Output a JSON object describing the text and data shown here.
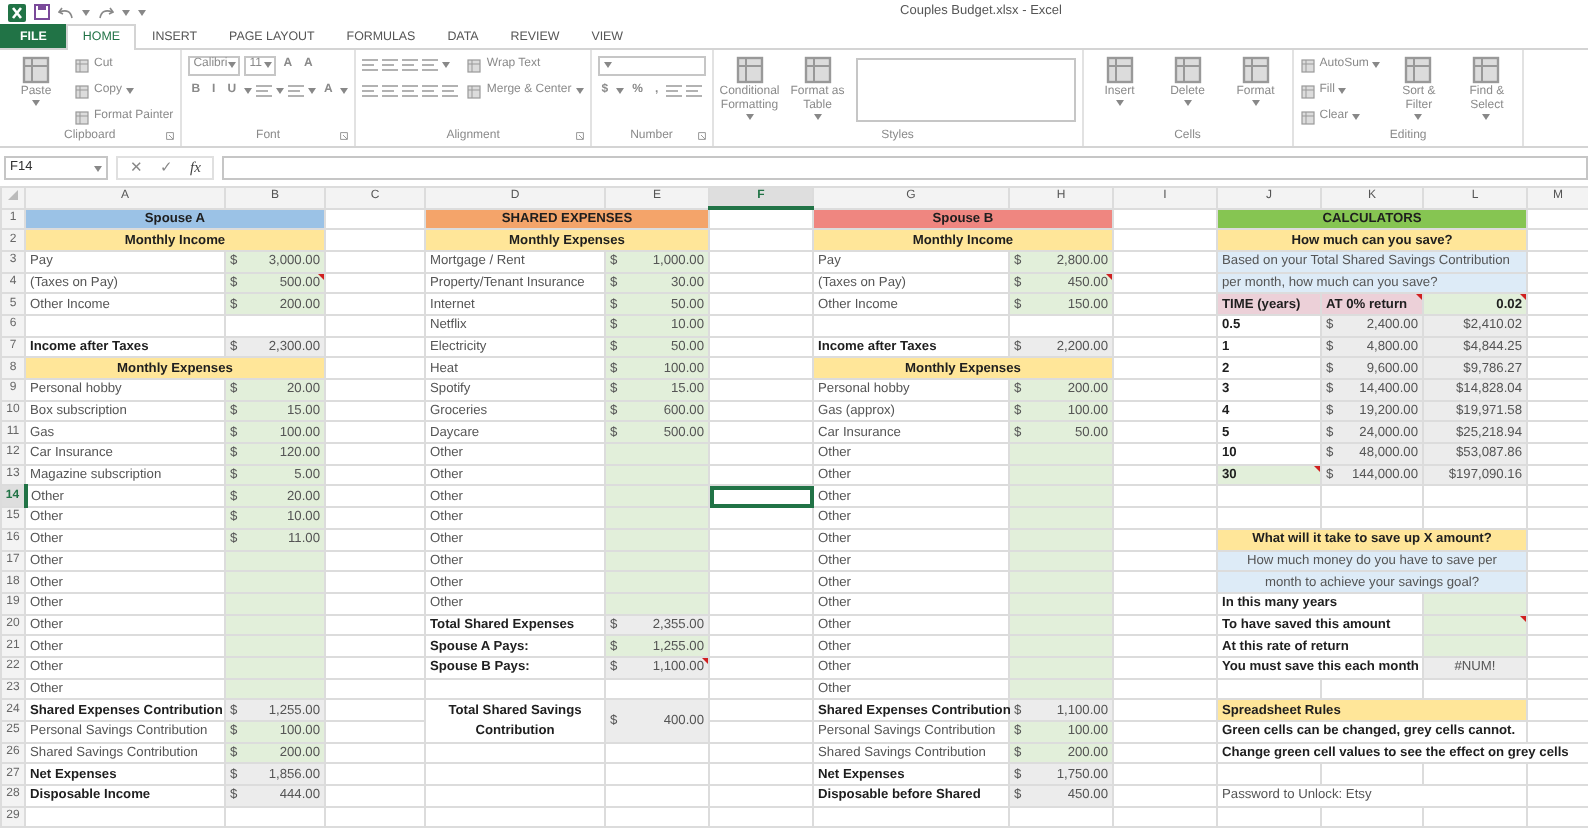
{
  "window": {
    "title": "Couples Budget.xlsx - Excel"
  },
  "tabs": [
    {
      "label": "FILE",
      "kind": "file",
      "selected": false
    },
    {
      "label": "HOME",
      "kind": "tab",
      "selected": true
    },
    {
      "label": "INSERT",
      "kind": "tab",
      "selected": false
    },
    {
      "label": "PAGE LAYOUT",
      "kind": "tab",
      "selected": false
    },
    {
      "label": "FORMULAS",
      "kind": "tab",
      "selected": false
    },
    {
      "label": "DATA",
      "kind": "tab",
      "selected": false
    },
    {
      "label": "REVIEW",
      "kind": "tab",
      "selected": false
    },
    {
      "label": "VIEW",
      "kind": "tab",
      "selected": false
    }
  ],
  "ribbon": {
    "disabled": true,
    "groups": [
      {
        "label": "Clipboard",
        "launcher": true,
        "columns": [
          [
            [
              {
                "kind": "large",
                "text": "Paste",
                "menu": true
              }
            ]
          ],
          [
            [
              {
                "kind": "small",
                "text": "Cut"
              }
            ],
            [
              {
                "kind": "small",
                "text": "Copy",
                "menu": true
              }
            ],
            [
              {
                "kind": "small",
                "text": "Format Painter"
              }
            ]
          ]
        ]
      },
      {
        "label": "Font",
        "launcher": true,
        "columns": [
          [
            [
              {
                "kind": "combo",
                "text": "Calibri"
              },
              {
                "kind": "combo",
                "text": "11"
              },
              {
                "kind": "glyph",
                "text": "A"
              },
              {
                "kind": "glyph",
                "text": "A"
              }
            ],
            [
              {
                "kind": "glyph",
                "text": "B"
              },
              {
                "kind": "glyph",
                "text": "I"
              },
              {
                "kind": "glyph",
                "text": "U",
                "menu": true
              },
              {
                "kind": "icon",
                "menu": true
              },
              {
                "kind": "icon",
                "menu": true
              },
              {
                "kind": "glyph",
                "text": "A",
                "menu": true
              }
            ]
          ]
        ]
      },
      {
        "label": "Alignment",
        "launcher": true,
        "columns": [
          [
            [
              {
                "kind": "icon"
              },
              {
                "kind": "icon"
              },
              {
                "kind": "icon"
              },
              {
                "kind": "icon",
                "menu": true
              }
            ],
            [
              {
                "kind": "icon"
              },
              {
                "kind": "icon"
              },
              {
                "kind": "icon"
              },
              {
                "kind": "icon"
              },
              {
                "kind": "icon"
              }
            ]
          ],
          [
            [
              {
                "kind": "small",
                "text": "Wrap Text"
              }
            ],
            [
              {
                "kind": "small",
                "text": "Merge & Center",
                "menu": true
              }
            ]
          ]
        ]
      },
      {
        "label": "Number",
        "launcher": true,
        "columns": [
          [
            [
              {
                "kind": "select"
              }
            ],
            [
              {
                "kind": "glyph",
                "text": "$",
                "menu": true
              },
              {
                "kind": "glyph",
                "text": "%"
              },
              {
                "kind": "glyph",
                "text": ","
              },
              {
                "kind": "icon"
              },
              {
                "kind": "icon"
              }
            ]
          ]
        ]
      },
      {
        "label": "Styles",
        "columns": [
          [
            [
              {
                "kind": "large",
                "text": "Conditional Formatting",
                "menu": true
              }
            ]
          ],
          [
            [
              {
                "kind": "large",
                "text": "Format as Table",
                "menu": true
              }
            ]
          ],
          [
            [
              {
                "kind": "gallery"
              }
            ]
          ]
        ]
      },
      {
        "label": "Cells",
        "columns": [
          [
            [
              {
                "kind": "large",
                "text": "Insert",
                "menu": true
              }
            ]
          ],
          [
            [
              {
                "kind": "large",
                "text": "Delete",
                "menu": true
              }
            ]
          ],
          [
            [
              {
                "kind": "large",
                "text": "Format",
                "menu": true
              }
            ]
          ]
        ]
      },
      {
        "label": "Editing",
        "columns": [
          [
            [
              {
                "kind": "small",
                "text": "AutoSum",
                "menu": true
              }
            ],
            [
              {
                "kind": "small",
                "text": "Fill",
                "menu": true
              }
            ],
            [
              {
                "kind": "small",
                "text": "Clear",
                "menu": true
              }
            ]
          ],
          [
            [
              {
                "kind": "large",
                "text": "Sort & Filter",
                "menu": true
              }
            ]
          ],
          [
            [
              {
                "kind": "large",
                "text": "Find & Select",
                "menu": true
              }
            ]
          ]
        ]
      }
    ]
  },
  "formula_bar": {
    "name_box": "F14",
    "cancel": "✕",
    "enter": "✓",
    "function": "fx"
  },
  "sheet": {
    "columns": [
      {
        "label": "A",
        "selected": false
      },
      {
        "label": "B",
        "selected": false
      },
      {
        "label": "C",
        "selected": false
      },
      {
        "label": "D",
        "selected": false
      },
      {
        "label": "E",
        "selected": false
      },
      {
        "label": "F",
        "selected": true
      },
      {
        "label": "G",
        "selected": false
      },
      {
        "label": "H",
        "selected": false
      },
      {
        "label": "I",
        "selected": false
      },
      {
        "label": "J",
        "selected": false
      },
      {
        "label": "K",
        "selected": false
      },
      {
        "label": "L",
        "selected": false
      },
      {
        "label": "M",
        "selected": false
      }
    ],
    "rows": [
      {
        "number": "1",
        "selected": false,
        "cells": [
          {
            "text": "Spouse A",
            "kind": "title",
            "color": "#9bc2e6",
            "bold": true,
            "colspan": 2
          },
          "",
          {
            "text": "SHARED EXPENSES",
            "kind": "title",
            "color": "#f4a46a",
            "bold": true,
            "colspan": 2
          },
          "",
          {
            "text": "Spouse B",
            "kind": "title",
            "color": "#ef8680",
            "bold": true,
            "colspan": 2
          },
          "",
          {
            "text": "CALCULATORS",
            "kind": "title",
            "color": "#86c552",
            "bold": true,
            "colspan": 3
          }
        ]
      },
      {
        "number": "2",
        "selected": false,
        "cells": [
          {
            "text": "Monthly Income",
            "kind": "section",
            "bold": true,
            "colspan": 2
          },
          "",
          {
            "text": "Monthly Expenses",
            "kind": "section",
            "bold": true,
            "colspan": 2
          },
          "",
          {
            "text": "Monthly Income",
            "kind": "section",
            "bold": true,
            "colspan": 2
          },
          "",
          {
            "text": "How much can you save?",
            "kind": "section",
            "bold": true,
            "colspan": 3
          }
        ]
      },
      {
        "number": "3",
        "selected": false,
        "cells": [
          "Pay",
          {
            "currency": "$",
            "text": "3,000.00",
            "kind": "input"
          },
          "",
          "Mortgage / Rent",
          {
            "currency": "$",
            "text": "1,000.00",
            "kind": "input"
          },
          "",
          "Pay",
          {
            "currency": "$",
            "text": "2,800.00",
            "kind": "input"
          },
          "",
          {
            "text": "Based on your Total Shared Savings Contribution",
            "kind": "note",
            "colspan": 3
          }
        ]
      },
      {
        "number": "4",
        "selected": false,
        "cells": [
          "(Taxes on Pay)",
          {
            "currency": "$",
            "text": "500.00",
            "kind": "input",
            "comment": true
          },
          "",
          "Property/Tenant Insurance",
          {
            "currency": "$",
            "text": "30.00",
            "kind": "input"
          },
          "",
          "(Taxes on Pay)",
          {
            "currency": "$",
            "text": "450.00",
            "kind": "input",
            "comment": true
          },
          "",
          {
            "text": "per month, how much can you save?",
            "kind": "note",
            "colspan": 3
          }
        ]
      },
      {
        "number": "5",
        "selected": false,
        "cells": [
          "Other Income",
          {
            "currency": "$",
            "text": "200.00",
            "kind": "input"
          },
          "",
          "Internet",
          {
            "currency": "$",
            "text": "50.00",
            "kind": "input"
          },
          "",
          "Other Income",
          {
            "currency": "$",
            "text": "150.00",
            "kind": "input"
          },
          "",
          {
            "text": "TIME (years)",
            "kind": "label",
            "bold": true
          },
          {
            "text": "AT 0% return",
            "kind": "label",
            "bold": true,
            "comment": true
          },
          {
            "text": "0.02",
            "kind": "rate",
            "bold": true,
            "comment": true
          }
        ]
      },
      {
        "number": "6",
        "selected": false,
        "cells": [
          "",
          "",
          "",
          "Netflix",
          {
            "currency": "$",
            "text": "10.00",
            "kind": "input"
          },
          "",
          "",
          "",
          "",
          {
            "text": "0.5",
            "bold": true
          },
          {
            "currency": "$",
            "text": "2,400.00",
            "kind": "formula"
          },
          {
            "text": "$2,410.02",
            "kind": "formula"
          }
        ]
      },
      {
        "number": "7",
        "selected": false,
        "cells": [
          {
            "text": "Income after Taxes",
            "bold": true
          },
          {
            "currency": "$",
            "text": "2,300.00",
            "kind": "formula"
          },
          "",
          "Electricity",
          {
            "currency": "$",
            "text": "50.00",
            "kind": "input"
          },
          "",
          {
            "text": "Income after Taxes",
            "bold": true
          },
          {
            "currency": "$",
            "text": "2,200.00",
            "kind": "formula"
          },
          "",
          {
            "text": "1",
            "bold": true
          },
          {
            "currency": "$",
            "text": "4,800.00",
            "kind": "formula"
          },
          {
            "text": "$4,844.25",
            "kind": "formula"
          }
        ]
      },
      {
        "number": "8",
        "selected": false,
        "cells": [
          {
            "text": "Monthly Expenses",
            "kind": "section",
            "bold": true,
            "colspan": 2
          },
          "",
          "Heat",
          {
            "currency": "$",
            "text": "100.00",
            "kind": "input"
          },
          "",
          {
            "text": "Monthly Expenses",
            "kind": "section",
            "bold": true,
            "colspan": 2
          },
          "",
          {
            "text": "2",
            "bold": true
          },
          {
            "currency": "$",
            "text": "9,600.00",
            "kind": "formula"
          },
          {
            "text": "$9,786.27",
            "kind": "formula"
          }
        ]
      },
      {
        "number": "9",
        "selected": false,
        "cells": [
          "Personal hobby",
          {
            "currency": "$",
            "text": "20.00",
            "kind": "input"
          },
          "",
          "Spotify",
          {
            "currency": "$",
            "text": "15.00",
            "kind": "input"
          },
          "",
          "Personal hobby",
          {
            "currency": "$",
            "text": "200.00",
            "kind": "input"
          },
          "",
          {
            "text": "3",
            "bold": true
          },
          {
            "currency": "$",
            "text": "14,400.00",
            "kind": "formula"
          },
          {
            "text": "$14,828.04",
            "kind": "formula"
          }
        ]
      },
      {
        "number": "10",
        "selected": false,
        "cells": [
          "Box subscription",
          {
            "currency": "$",
            "text": "15.00",
            "kind": "input"
          },
          "",
          "Groceries",
          {
            "currency": "$",
            "text": "600.00",
            "kind": "input"
          },
          "",
          "Gas (approx)",
          {
            "currency": "$",
            "text": "100.00",
            "kind": "input"
          },
          "",
          {
            "text": "4",
            "bold": true
          },
          {
            "currency": "$",
            "text": "19,200.00",
            "kind": "formula"
          },
          {
            "text": "$19,971.58",
            "kind": "formula"
          }
        ]
      },
      {
        "number": "11",
        "selected": false,
        "cells": [
          "Gas",
          {
            "currency": "$",
            "text": "100.00",
            "kind": "input"
          },
          "",
          "Daycare",
          {
            "currency": "$",
            "text": "500.00",
            "kind": "input"
          },
          "",
          "Car Insurance",
          {
            "currency": "$",
            "text": "50.00",
            "kind": "input"
          },
          "",
          {
            "text": "5",
            "bold": true
          },
          {
            "currency": "$",
            "text": "24,000.00",
            "kind": "formula"
          },
          {
            "text": "$25,218.94",
            "kind": "formula"
          }
        ]
      },
      {
        "number": "12",
        "selected": false,
        "cells": [
          "Car Insurance",
          {
            "currency": "$",
            "text": "120.00",
            "kind": "input"
          },
          "",
          "Other",
          {
            "kind": "input"
          },
          "",
          "Other",
          {
            "kind": "input"
          },
          "",
          {
            "text": "10",
            "bold": true
          },
          {
            "currency": "$",
            "text": "48,000.00",
            "kind": "formula"
          },
          {
            "text": "$53,087.86",
            "kind": "formula"
          }
        ]
      },
      {
        "number": "13",
        "selected": false,
        "cells": [
          "Magazine subscription",
          {
            "currency": "$",
            "text": "5.00",
            "kind": "input"
          },
          "",
          "Other",
          {
            "kind": "input"
          },
          "",
          "Other",
          {
            "kind": "input"
          },
          "",
          {
            "text": "30",
            "kind": "input",
            "bold": true,
            "comment": true
          },
          {
            "currency": "$",
            "text": "144,000.00",
            "kind": "formula"
          },
          {
            "text": "$197,090.16",
            "kind": "formula"
          }
        ]
      },
      {
        "number": "14",
        "selected": true,
        "cells": [
          "Other",
          {
            "currency": "$",
            "text": "20.00",
            "kind": "input"
          },
          "",
          "Other",
          {
            "kind": "input"
          },
          "",
          "Other",
          {
            "kind": "input"
          }
        ]
      },
      {
        "number": "15",
        "selected": false,
        "cells": [
          "Other",
          {
            "currency": "$",
            "text": "10.00",
            "kind": "input"
          },
          "",
          "Other",
          {
            "kind": "input"
          },
          "",
          "Other",
          {
            "kind": "input"
          }
        ]
      },
      {
        "number": "16",
        "selected": false,
        "cells": [
          "Other",
          {
            "currency": "$",
            "text": "11.00",
            "kind": "input"
          },
          "",
          "Other",
          {
            "kind": "input"
          },
          "",
          "Other",
          {
            "kind": "input"
          },
          "",
          {
            "text": "What will it take to save up X amount?",
            "kind": "section",
            "bold": true,
            "colspan": 3
          }
        ]
      },
      {
        "number": "17",
        "selected": false,
        "cells": [
          "Other",
          {
            "kind": "input"
          },
          "",
          "Other",
          {
            "kind": "input"
          },
          "",
          "Other",
          {
            "kind": "input"
          },
          "",
          {
            "text": "How much money do you have to save per",
            "kind": "prompt",
            "colspan": 3
          }
        ]
      },
      {
        "number": "18",
        "selected": false,
        "cells": [
          "Other",
          {
            "kind": "input"
          },
          "",
          "Other",
          {
            "kind": "input"
          },
          "",
          "Other",
          {
            "kind": "input"
          },
          "",
          {
            "text": "month to achieve your savings goal?",
            "kind": "prompt",
            "colspan": 3
          }
        ]
      },
      {
        "number": "19",
        "selected": false,
        "cells": [
          "Other",
          {
            "kind": "input"
          },
          "",
          "Other",
          {
            "kind": "input"
          },
          "",
          "Other",
          {
            "kind": "input"
          },
          "",
          {
            "text": "In this many years",
            "bold": true,
            "colspan": 2
          },
          {
            "kind": "input"
          }
        ]
      },
      {
        "number": "20",
        "selected": false,
        "cells": [
          "Other",
          {
            "kind": "input"
          },
          "",
          {
            "text": "Total Shared Expenses",
            "bold": true
          },
          {
            "currency": "$",
            "text": "2,355.00",
            "kind": "formula"
          },
          "",
          "Other",
          {
            "kind": "input"
          },
          "",
          {
            "text": "To have saved this amount",
            "bold": true,
            "colspan": 2
          },
          {
            "kind": "input",
            "comment": true
          }
        ]
      },
      {
        "number": "21",
        "selected": false,
        "cells": [
          "Other",
          {
            "kind": "input"
          },
          "",
          {
            "text": "Spouse A Pays:",
            "bold": true
          },
          {
            "currency": "$",
            "text": "1,255.00",
            "kind": "input"
          },
          "",
          "Other",
          {
            "kind": "input"
          },
          "",
          {
            "text": "At this rate of return",
            "bold": true,
            "colspan": 2
          },
          {
            "kind": "input"
          }
        ]
      },
      {
        "number": "22",
        "selected": false,
        "cells": [
          "Other",
          {
            "kind": "input"
          },
          "",
          {
            "text": "Spouse B Pays:",
            "bold": true
          },
          {
            "currency": "$",
            "text": "1,100.00",
            "kind": "formula",
            "comment": true
          },
          "",
          "Other",
          {
            "kind": "input"
          },
          "",
          {
            "text": "You must save this each month",
            "bold": true,
            "colspan": 2
          },
          {
            "text": "#NUM!",
            "kind": "error"
          }
        ]
      },
      {
        "number": "23",
        "selected": false,
        "cells": [
          "Other",
          {
            "kind": "input"
          },
          "",
          "",
          "",
          "",
          "Other",
          {
            "kind": "input"
          }
        ]
      },
      {
        "number": "24",
        "selected": false,
        "cells": [
          {
            "text": "Shared Expenses Contribution",
            "bold": true
          },
          {
            "currency": "$",
            "text": "1,255.00",
            "kind": "formula"
          },
          "",
          {
            "text": "Total Shared Savings Contribution",
            "kind": "caption",
            "bold": true,
            "rowspan": 2
          },
          {
            "currency": "$",
            "text": "400.00",
            "kind": "formula",
            "rowspan": 2
          },
          "",
          {
            "text": "Shared Expenses Contribution",
            "bold": true
          },
          {
            "currency": "$",
            "text": "1,100.00",
            "kind": "formula"
          },
          "",
          {
            "text": "Spreadsheet Rules",
            "kind": "heading",
            "bold": true,
            "colspan": 3
          }
        ]
      },
      {
        "number": "25",
        "selected": false,
        "cells": [
          "Personal Savings Contribution",
          {
            "currency": "$",
            "text": "100.00",
            "kind": "input"
          },
          "",
          "",
          "Personal Savings Contribution",
          {
            "currency": "$",
            "text": "100.00",
            "kind": "input"
          },
          "",
          {
            "text": "Green cells can be changed, grey cells cannot.",
            "bold": true,
            "colspan": 3
          }
        ]
      },
      {
        "number": "26",
        "selected": false,
        "cells": [
          "Shared Savings Contribution",
          {
            "currency": "$",
            "text": "200.00",
            "kind": "input"
          },
          "",
          "",
          "",
          "",
          "Shared Savings Contribution",
          {
            "currency": "$",
            "text": "200.00",
            "kind": "input"
          },
          "",
          {
            "text": "Change green cell values to see the effect on grey cells",
            "bold": true,
            "colspan": 4
          }
        ]
      },
      {
        "number": "27",
        "selected": false,
        "cells": [
          {
            "text": "Net Expenses",
            "bold": true
          },
          {
            "currency": "$",
            "text": "1,856.00",
            "kind": "formula"
          },
          "",
          "",
          "",
          "",
          {
            "text": "Net Expenses",
            "bold": true
          },
          {
            "currency": "$",
            "text": "1,750.00",
            "kind": "formula"
          }
        ]
      },
      {
        "number": "28",
        "selected": false,
        "cells": [
          {
            "text": "Disposable Income",
            "bold": true
          },
          {
            "currency": "$",
            "text": "444.00",
            "kind": "formula"
          },
          "",
          "",
          "",
          "",
          {
            "text": "Disposable before Shared",
            "bold": true
          },
          {
            "currency": "$",
            "text": "450.00",
            "kind": "formula"
          },
          "",
          {
            "text": "Password to Unlock: Etsy",
            "colspan": 3
          }
        ]
      },
      {
        "number": "29",
        "selected": false,
        "cells": []
      }
    ]
  }
}
